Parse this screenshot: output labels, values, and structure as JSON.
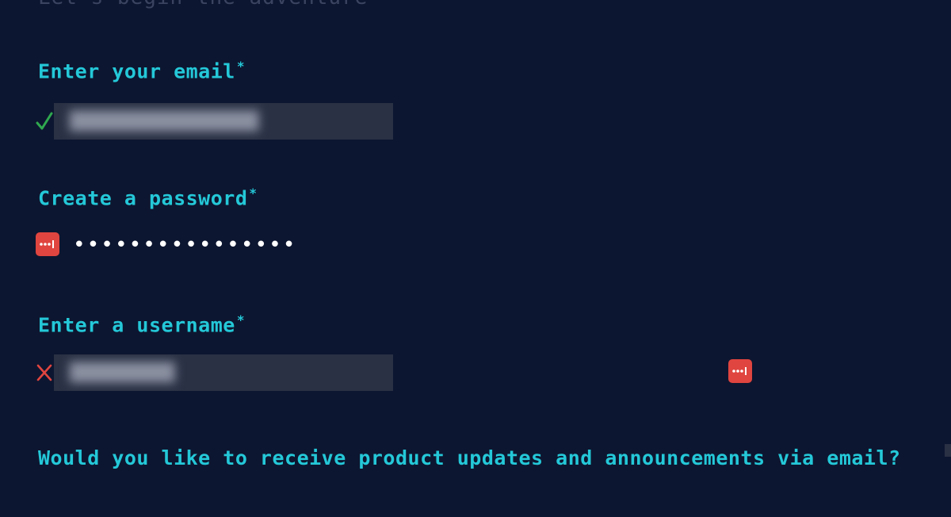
{
  "intro_text": "Let's begin the adventure",
  "email": {
    "label": "Enter your email",
    "required_mark": "*",
    "status": "valid",
    "value_redacted": "██████████████████"
  },
  "password": {
    "label": "Create a password",
    "required_mark": "*",
    "masked_value": "••••••••••••••••"
  },
  "username": {
    "label": "Enter a username",
    "required_mark": "*",
    "status": "invalid",
    "value_redacted": "██████████"
  },
  "question": "Would you like to receive product updates and announcements via email?",
  "colors": {
    "background": "#0d1630",
    "label": "#24c8d8",
    "valid": "#2fa84f",
    "invalid": "#e0453f",
    "password_manager": "#e0453f"
  },
  "icons": {
    "email_status": "check-icon",
    "username_status": "cross-icon",
    "password_manager": "password-manager-icon"
  }
}
